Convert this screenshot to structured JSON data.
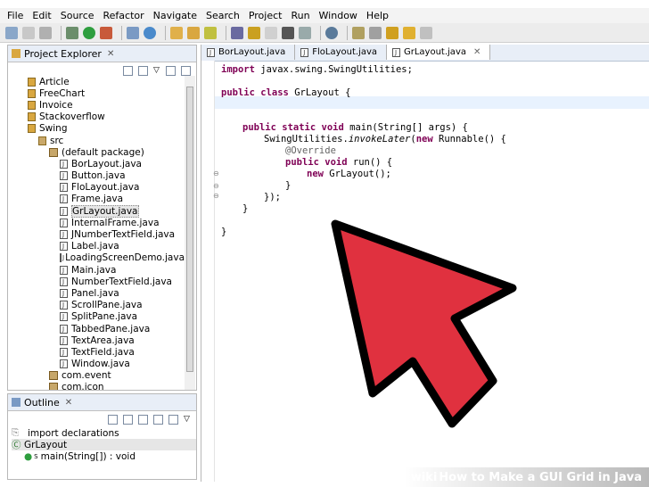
{
  "menu": [
    "File",
    "Edit",
    "Source",
    "Refactor",
    "Navigate",
    "Search",
    "Project",
    "Run",
    "Window",
    "Help"
  ],
  "project_explorer": {
    "title": "Project Explorer",
    "tree": [
      {
        "label": "Article",
        "icon": "project-folder-icon",
        "indent": 1
      },
      {
        "label": "FreeChart",
        "icon": "project-folder-icon",
        "indent": 1
      },
      {
        "label": "Invoice",
        "icon": "project-folder-icon",
        "indent": 1
      },
      {
        "label": "Stackoverflow",
        "icon": "project-folder-icon",
        "indent": 1
      },
      {
        "label": "Swing",
        "icon": "project-folder-icon",
        "indent": 1
      },
      {
        "label": "src",
        "icon": "source-folder-icon",
        "indent": 2
      },
      {
        "label": "(default package)",
        "icon": "package-icon",
        "indent": 3
      },
      {
        "label": "BorLayout.java",
        "icon": "java-file-icon",
        "indent": 4
      },
      {
        "label": "Button.java",
        "icon": "java-file-icon",
        "indent": 4
      },
      {
        "label": "FloLayout.java",
        "icon": "java-file-icon",
        "indent": 4
      },
      {
        "label": "Frame.java",
        "icon": "java-file-icon",
        "indent": 4
      },
      {
        "label": "GrLayout.java",
        "icon": "java-file-icon",
        "indent": 4,
        "selected": true
      },
      {
        "label": "InternalFrame.java",
        "icon": "java-file-icon",
        "indent": 4
      },
      {
        "label": "JNumberTextField.java",
        "icon": "java-file-icon",
        "indent": 4
      },
      {
        "label": "Label.java",
        "icon": "java-file-icon",
        "indent": 4
      },
      {
        "label": "LoadingScreenDemo.java",
        "icon": "java-file-icon",
        "indent": 4
      },
      {
        "label": "Main.java",
        "icon": "java-file-icon",
        "indent": 4
      },
      {
        "label": "NumberTextField.java",
        "icon": "java-file-icon",
        "indent": 4
      },
      {
        "label": "Panel.java",
        "icon": "java-file-icon",
        "indent": 4
      },
      {
        "label": "ScrollPane.java",
        "icon": "java-file-icon",
        "indent": 4
      },
      {
        "label": "SplitPane.java",
        "icon": "java-file-icon",
        "indent": 4
      },
      {
        "label": "TabbedPane.java",
        "icon": "java-file-icon",
        "indent": 4
      },
      {
        "label": "TextArea.java",
        "icon": "java-file-icon",
        "indent": 4
      },
      {
        "label": "TextField.java",
        "icon": "java-file-icon",
        "indent": 4
      },
      {
        "label": "Window.java",
        "icon": "java-file-icon",
        "indent": 4
      },
      {
        "label": "com.event",
        "icon": "package-icon",
        "indent": 3
      },
      {
        "label": "com.icon",
        "icon": "package-icon",
        "indent": 3
      }
    ]
  },
  "outline": {
    "title": "Outline",
    "items": [
      {
        "label": "import declarations",
        "indent": 1
      },
      {
        "label": "GrLayout",
        "indent": 1
      },
      {
        "label": "main(String[]) : void",
        "indent": 2
      }
    ],
    "static_marker": "S"
  },
  "editor": {
    "tabs": [
      {
        "label": "BorLayout.java",
        "active": false
      },
      {
        "label": "FloLayout.java",
        "active": false
      },
      {
        "label": "GrLayout.java",
        "active": true
      }
    ],
    "code_lines": [
      "import javax.swing.SwingUtilities;",
      "public class GrLayout {",
      "public static void main(String[] args) {",
      "SwingUtilities.invokeLater(new Runnable() {",
      "@Override",
      "public void run() {",
      "new GrLayout();",
      "}",
      "});",
      "}",
      "}"
    ]
  },
  "watermark": {
    "brand": "wiki",
    "title": "How to Make a GUI Grid in Java"
  },
  "colors": {
    "arrow": "#e0313f",
    "keyword": "#7f0055",
    "annotation": "#646464"
  }
}
